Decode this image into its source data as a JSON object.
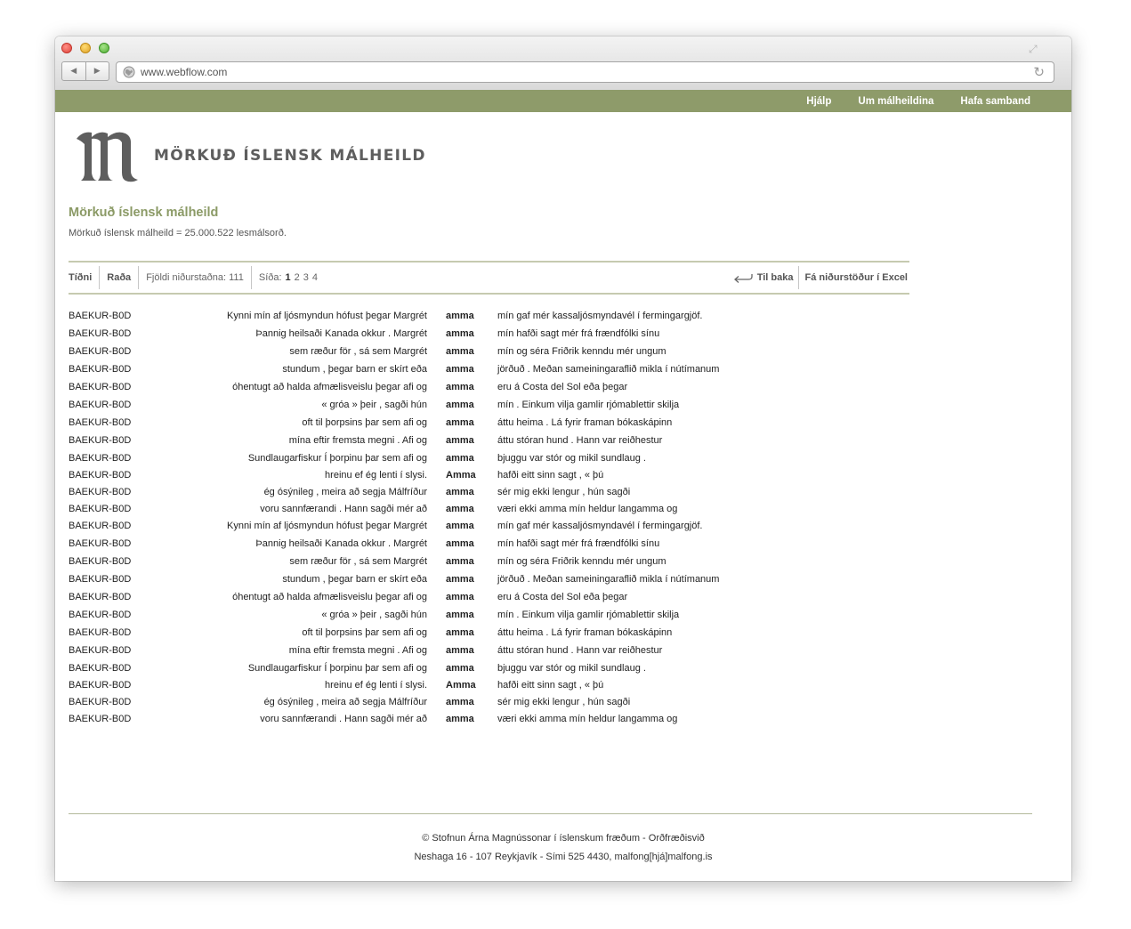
{
  "browser": {
    "url": "www.webflow.com"
  },
  "topnav": {
    "items": [
      "Hjálp",
      "Um málheildina",
      "Hafa samband"
    ]
  },
  "header": {
    "logo_text": "MÖRKUÐ ÍSLENSK MÁLHEILD"
  },
  "intro": {
    "title": "Mörkuð íslensk málheild",
    "description": "Mörkuð íslensk málheild = 25.000.522 lesmálsorð."
  },
  "toolbar": {
    "frequency": "Tíðni",
    "sort": "Raða",
    "result_count": "Fjöldi niðurstaðna: 111",
    "page_label": "Síða:",
    "pages": [
      "1",
      "2",
      "3",
      "4"
    ],
    "current_page": "1",
    "back": "Til baka",
    "excel": "Fá niðurstöður í Excel"
  },
  "results": [
    {
      "source": "BAEKUR-B0D",
      "left": "Kynni mín af ljósmyndun hófust þegar Margrét",
      "keyword": "amma",
      "right": "mín gaf mér kassaljósmyndavél í fermingargjöf."
    },
    {
      "source": "BAEKUR-B0D",
      "left": "Þannig heilsaði Kanada okkur . Margrét",
      "keyword": "amma",
      "right": "mín hafði sagt mér frá frændfólki sínu"
    },
    {
      "source": "BAEKUR-B0D",
      "left": "sem ræður för , sá sem Margrét",
      "keyword": "amma",
      "right": "mín og séra Friðrik kenndu mér ungum"
    },
    {
      "source": "BAEKUR-B0D",
      "left": "stundum , þegar barn er skírt eða",
      "keyword": "amma",
      "right": "jörðuð . Meðan sameiningaraflið mikla í nútímanum"
    },
    {
      "source": "BAEKUR-B0D",
      "left": "óhentugt að halda afmælisveislu þegar afi og",
      "keyword": "amma",
      "right": "eru á Costa del Sol eða þegar"
    },
    {
      "source": "BAEKUR-B0D",
      "left": "« gróa » þeir , sagði hún",
      "keyword": "amma",
      "right": "mín . Einkum vilja gamlir rjómablettir skilja"
    },
    {
      "source": "BAEKUR-B0D",
      "left": "oft til þorpsins þar sem afi og",
      "keyword": "amma",
      "right": "áttu heima . Lá fyrir framan bókaskápinn"
    },
    {
      "source": "BAEKUR-B0D",
      "left": "mína eftir fremsta megni . Afi og",
      "keyword": "amma",
      "right": "áttu stóran hund . Hann var reiðhestur"
    },
    {
      "source": "BAEKUR-B0D",
      "left": "Sundlaugarfiskur Í þorpinu þar sem afi og",
      "keyword": "amma",
      "right": "bjuggu var stór og mikil sundlaug ."
    },
    {
      "source": "BAEKUR-B0D",
      "left": "hreinu ef ég lenti í slysi.",
      "keyword": "Amma",
      "right": "hafði eitt sinn sagt , « þú"
    },
    {
      "source": "BAEKUR-B0D",
      "left": "ég ósýnileg , meira að segja Málfríður",
      "keyword": "amma",
      "right": "sér mig ekki lengur , hún sagði"
    },
    {
      "source": "BAEKUR-B0D",
      "left": "voru sannfærandi . Hann sagði mér að",
      "keyword": "amma",
      "right": "væri ekki amma mín heldur langamma og"
    },
    {
      "source": "BAEKUR-B0D",
      "left": "Kynni mín af ljósmyndun hófust þegar Margrét",
      "keyword": "amma",
      "right": "mín gaf mér kassaljósmyndavél í fermingargjöf."
    },
    {
      "source": "BAEKUR-B0D",
      "left": "Þannig heilsaði Kanada okkur . Margrét",
      "keyword": "amma",
      "right": "mín hafði sagt mér frá frændfólki sínu"
    },
    {
      "source": "BAEKUR-B0D",
      "left": "sem ræður för , sá sem Margrét",
      "keyword": "amma",
      "right": "mín og séra Friðrik kenndu mér ungum"
    },
    {
      "source": "BAEKUR-B0D",
      "left": "stundum , þegar barn er skírt eða",
      "keyword": "amma",
      "right": "jörðuð . Meðan sameiningaraflið mikla í nútímanum"
    },
    {
      "source": "BAEKUR-B0D",
      "left": "óhentugt að halda afmælisveislu þegar afi og",
      "keyword": "amma",
      "right": "eru á Costa del Sol eða þegar"
    },
    {
      "source": "BAEKUR-B0D",
      "left": "« gróa » þeir , sagði hún",
      "keyword": "amma",
      "right": "mín . Einkum vilja gamlir rjómablettir skilja"
    },
    {
      "source": "BAEKUR-B0D",
      "left": "oft til þorpsins þar sem afi og",
      "keyword": "amma",
      "right": "áttu heima . Lá fyrir framan bókaskápinn"
    },
    {
      "source": "BAEKUR-B0D",
      "left": "mína eftir fremsta megni . Afi og",
      "keyword": "amma",
      "right": "áttu stóran hund . Hann var reiðhestur"
    },
    {
      "source": "BAEKUR-B0D",
      "left": "Sundlaugarfiskur Í þorpinu þar sem afi og",
      "keyword": "amma",
      "right": "bjuggu var stór og mikil sundlaug ."
    },
    {
      "source": "BAEKUR-B0D",
      "left": "hreinu ef ég lenti í slysi.",
      "keyword": "Amma",
      "right": "hafði eitt sinn sagt , « þú"
    },
    {
      "source": "BAEKUR-B0D",
      "left": "ég ósýnileg , meira að segja Málfríður",
      "keyword": "amma",
      "right": "sér mig ekki lengur , hún sagði"
    },
    {
      "source": "BAEKUR-B0D",
      "left": "voru sannfærandi . Hann sagði mér að",
      "keyword": "amma",
      "right": "væri ekki amma mín heldur langamma og"
    }
  ],
  "footer": {
    "line1": "© Stofnun Árna Magnússonar í íslenskum fræðum - Orðfræðisvið",
    "line2": "Neshaga 16 - 107 Reykjavík - Sími 525 4430, malfong[hjá]malfong.is"
  },
  "colors": {
    "accent": "#8e9b6a",
    "title": "#8b9a66",
    "logo": "#5e5e5e"
  },
  "icons": [
    "globe-icon",
    "reload-icon",
    "back-arrow-icon",
    "fullscreen-icon"
  ]
}
